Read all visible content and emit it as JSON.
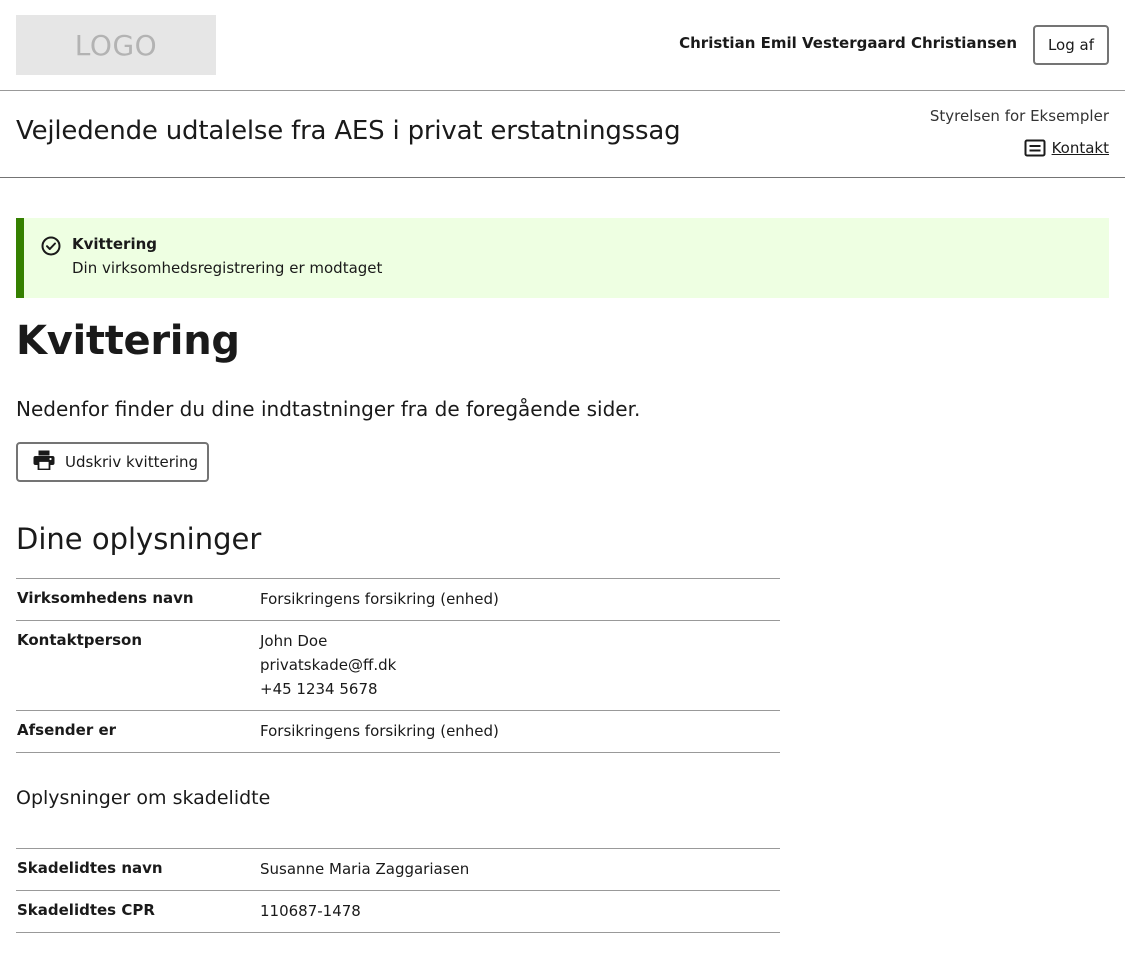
{
  "topbar": {
    "logo_text": "LOGO",
    "user_name": "Christian Emil Vestergaard Christiansen",
    "logout_label": "Log af"
  },
  "header": {
    "title": "Vejledende udtalelse fra AES i privat erstatningssag",
    "authority": "Styrelsen for Eksempler",
    "contact_label": "Kontakt",
    "contact_icon": "contact-card-icon"
  },
  "alert": {
    "type": "success",
    "icon": "check-circle-icon",
    "heading": "Kvittering",
    "text": "Din virksomhedsregistrering er modtaget",
    "accent_color": "#358000",
    "background_color": "#eeffe2"
  },
  "main": {
    "title": "Kvittering",
    "lead": "Nedenfor finder du dine indtastninger fra de foregående sider.",
    "print_button": {
      "label": "Udskriv kvittering",
      "icon": "printer-icon"
    },
    "section1": {
      "heading": "Dine oplysninger",
      "rows": [
        {
          "label": "Virksomhedens navn",
          "values": [
            "Forsikringens forsikring (enhed)"
          ]
        },
        {
          "label": "Kontaktperson",
          "values": [
            "John Doe",
            "privatskade@ff.dk",
            "+45 1234 5678"
          ]
        },
        {
          "label": "Afsender er",
          "values": [
            "Forsikringens forsikring (enhed)"
          ]
        }
      ]
    },
    "section2": {
      "heading": "Oplysninger om skadelidte",
      "rows": [
        {
          "label": "Skadelidtes navn",
          "values": [
            "Susanne Maria Zaggariasen"
          ]
        },
        {
          "label": "Skadelidtes CPR",
          "values": [
            "110687-1478"
          ]
        }
      ]
    }
  }
}
